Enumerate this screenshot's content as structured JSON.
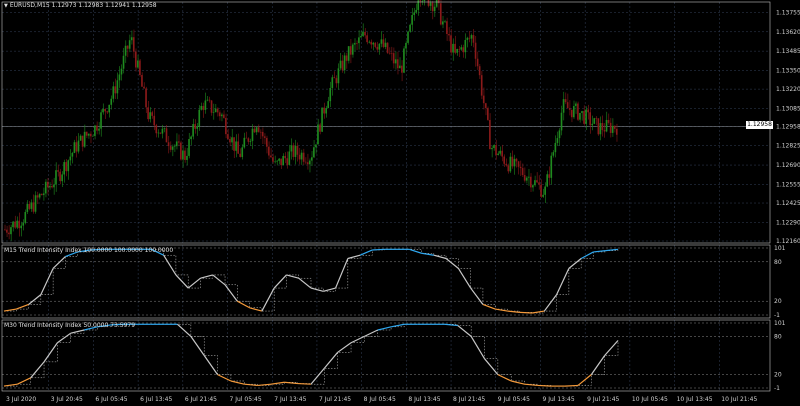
{
  "main_pane": {
    "symbol_line": "EURUSD,M15  1.12973 1.12983 1.12941 1.12958",
    "current_price": "1.12958",
    "price_ticks": [
      "1.13755",
      "1.13620",
      "1.13485",
      "1.13350",
      "1.13220",
      "1.13085",
      "1.12958",
      "1.12825",
      "1.12690",
      "1.12555",
      "1.12425",
      "1.12290",
      "1.12160"
    ]
  },
  "indicator_m15": {
    "label": "M15 Trend Intensity Index 100.0000 100.0000 100.0000",
    "levels": [
      "101",
      "80",
      "20",
      "-1"
    ]
  },
  "indicator_m30": {
    "label": "M30 Trend Intensity Index 50.0000 73.5979",
    "levels": [
      "101",
      "80",
      "20",
      "-1"
    ]
  },
  "time_axis": [
    "3 Jul 2020",
    "3 Jul 20:45",
    "6 Jul 05:45",
    "6 Jul 13:45",
    "6 Jul 21:45",
    "7 Jul 05:45",
    "7 Jul 13:45",
    "7 Jul 21:45",
    "8 Jul 05:45",
    "8 Jul 13:45",
    "8 Jul 21:45",
    "9 Jul 05:45",
    "9 Jul 13:45",
    "9 Jul 21:45",
    "10 Jul 05:45",
    "10 Jul 13:45",
    "10 Jul 21:45"
  ],
  "colors": {
    "background": "#000000",
    "bull": "#1f8b1f",
    "bear": "#8b1a1a",
    "tii_up": "#2fa8f0",
    "tii_down": "#f59a3a",
    "tii_mid": "#c8c8c8",
    "grid": "#33405a"
  },
  "chart_data": {
    "type": "line",
    "title": "EURUSD,M15",
    "price_series": {
      "name": "EURUSD,M15",
      "x": [
        "3 Jul 2020",
        "3 Jul 20:45",
        "6 Jul 05:45",
        "6 Jul 13:45",
        "6 Jul 21:45",
        "7 Jul 05:45",
        "7 Jul 13:45",
        "7 Jul 21:45",
        "8 Jul 05:45",
        "8 Jul 13:45",
        "8 Jul 21:45",
        "9 Jul 05:45",
        "9 Jul 13:45",
        "9 Jul 21:45",
        "10 Jul 05:45",
        "10 Jul 13:45",
        "10 Jul 21:45"
      ],
      "close_path": [
        1.1224,
        1.1232,
        1.1248,
        1.1262,
        1.1283,
        1.1295,
        1.1318,
        1.1358,
        1.1302,
        1.1288,
        1.1275,
        1.1312,
        1.1305,
        1.1275,
        1.13,
        1.1268,
        1.1278,
        1.1275,
        1.132,
        1.1345,
        1.136,
        1.1352,
        1.1335,
        1.139,
        1.138,
        1.1345,
        1.136,
        1.1282,
        1.127,
        1.1262,
        1.125,
        1.131,
        1.1305,
        1.1295,
        1.1296
      ],
      "ylim": [
        1.1216,
        1.138
      ]
    },
    "tii_m15": {
      "name": "M15 Trend Intensity Index",
      "ylim": [
        -1,
        101
      ],
      "values": [
        5,
        8,
        15,
        30,
        70,
        88,
        95,
        98,
        99,
        99,
        99,
        99,
        99,
        90,
        60,
        40,
        55,
        60,
        45,
        20,
        10,
        5,
        40,
        60,
        55,
        40,
        35,
        40,
        85,
        90,
        98,
        99,
        99,
        99,
        93,
        90,
        85,
        70,
        40,
        15,
        8,
        5,
        3,
        2,
        5,
        30,
        70,
        85,
        95,
        97,
        99
      ]
    },
    "tii_m30": {
      "name": "M30 Trend Intensity Index",
      "ylim": [
        -1,
        101
      ],
      "values": [
        2,
        5,
        15,
        40,
        70,
        85,
        90,
        95,
        98,
        99,
        99,
        99,
        99,
        99,
        80,
        50,
        20,
        10,
        5,
        3,
        5,
        8,
        6,
        5,
        30,
        55,
        70,
        80,
        90,
        95,
        99,
        99,
        99,
        99,
        97,
        80,
        45,
        20,
        10,
        5,
        3,
        2,
        2,
        3,
        20,
        50,
        73.6
      ]
    }
  }
}
